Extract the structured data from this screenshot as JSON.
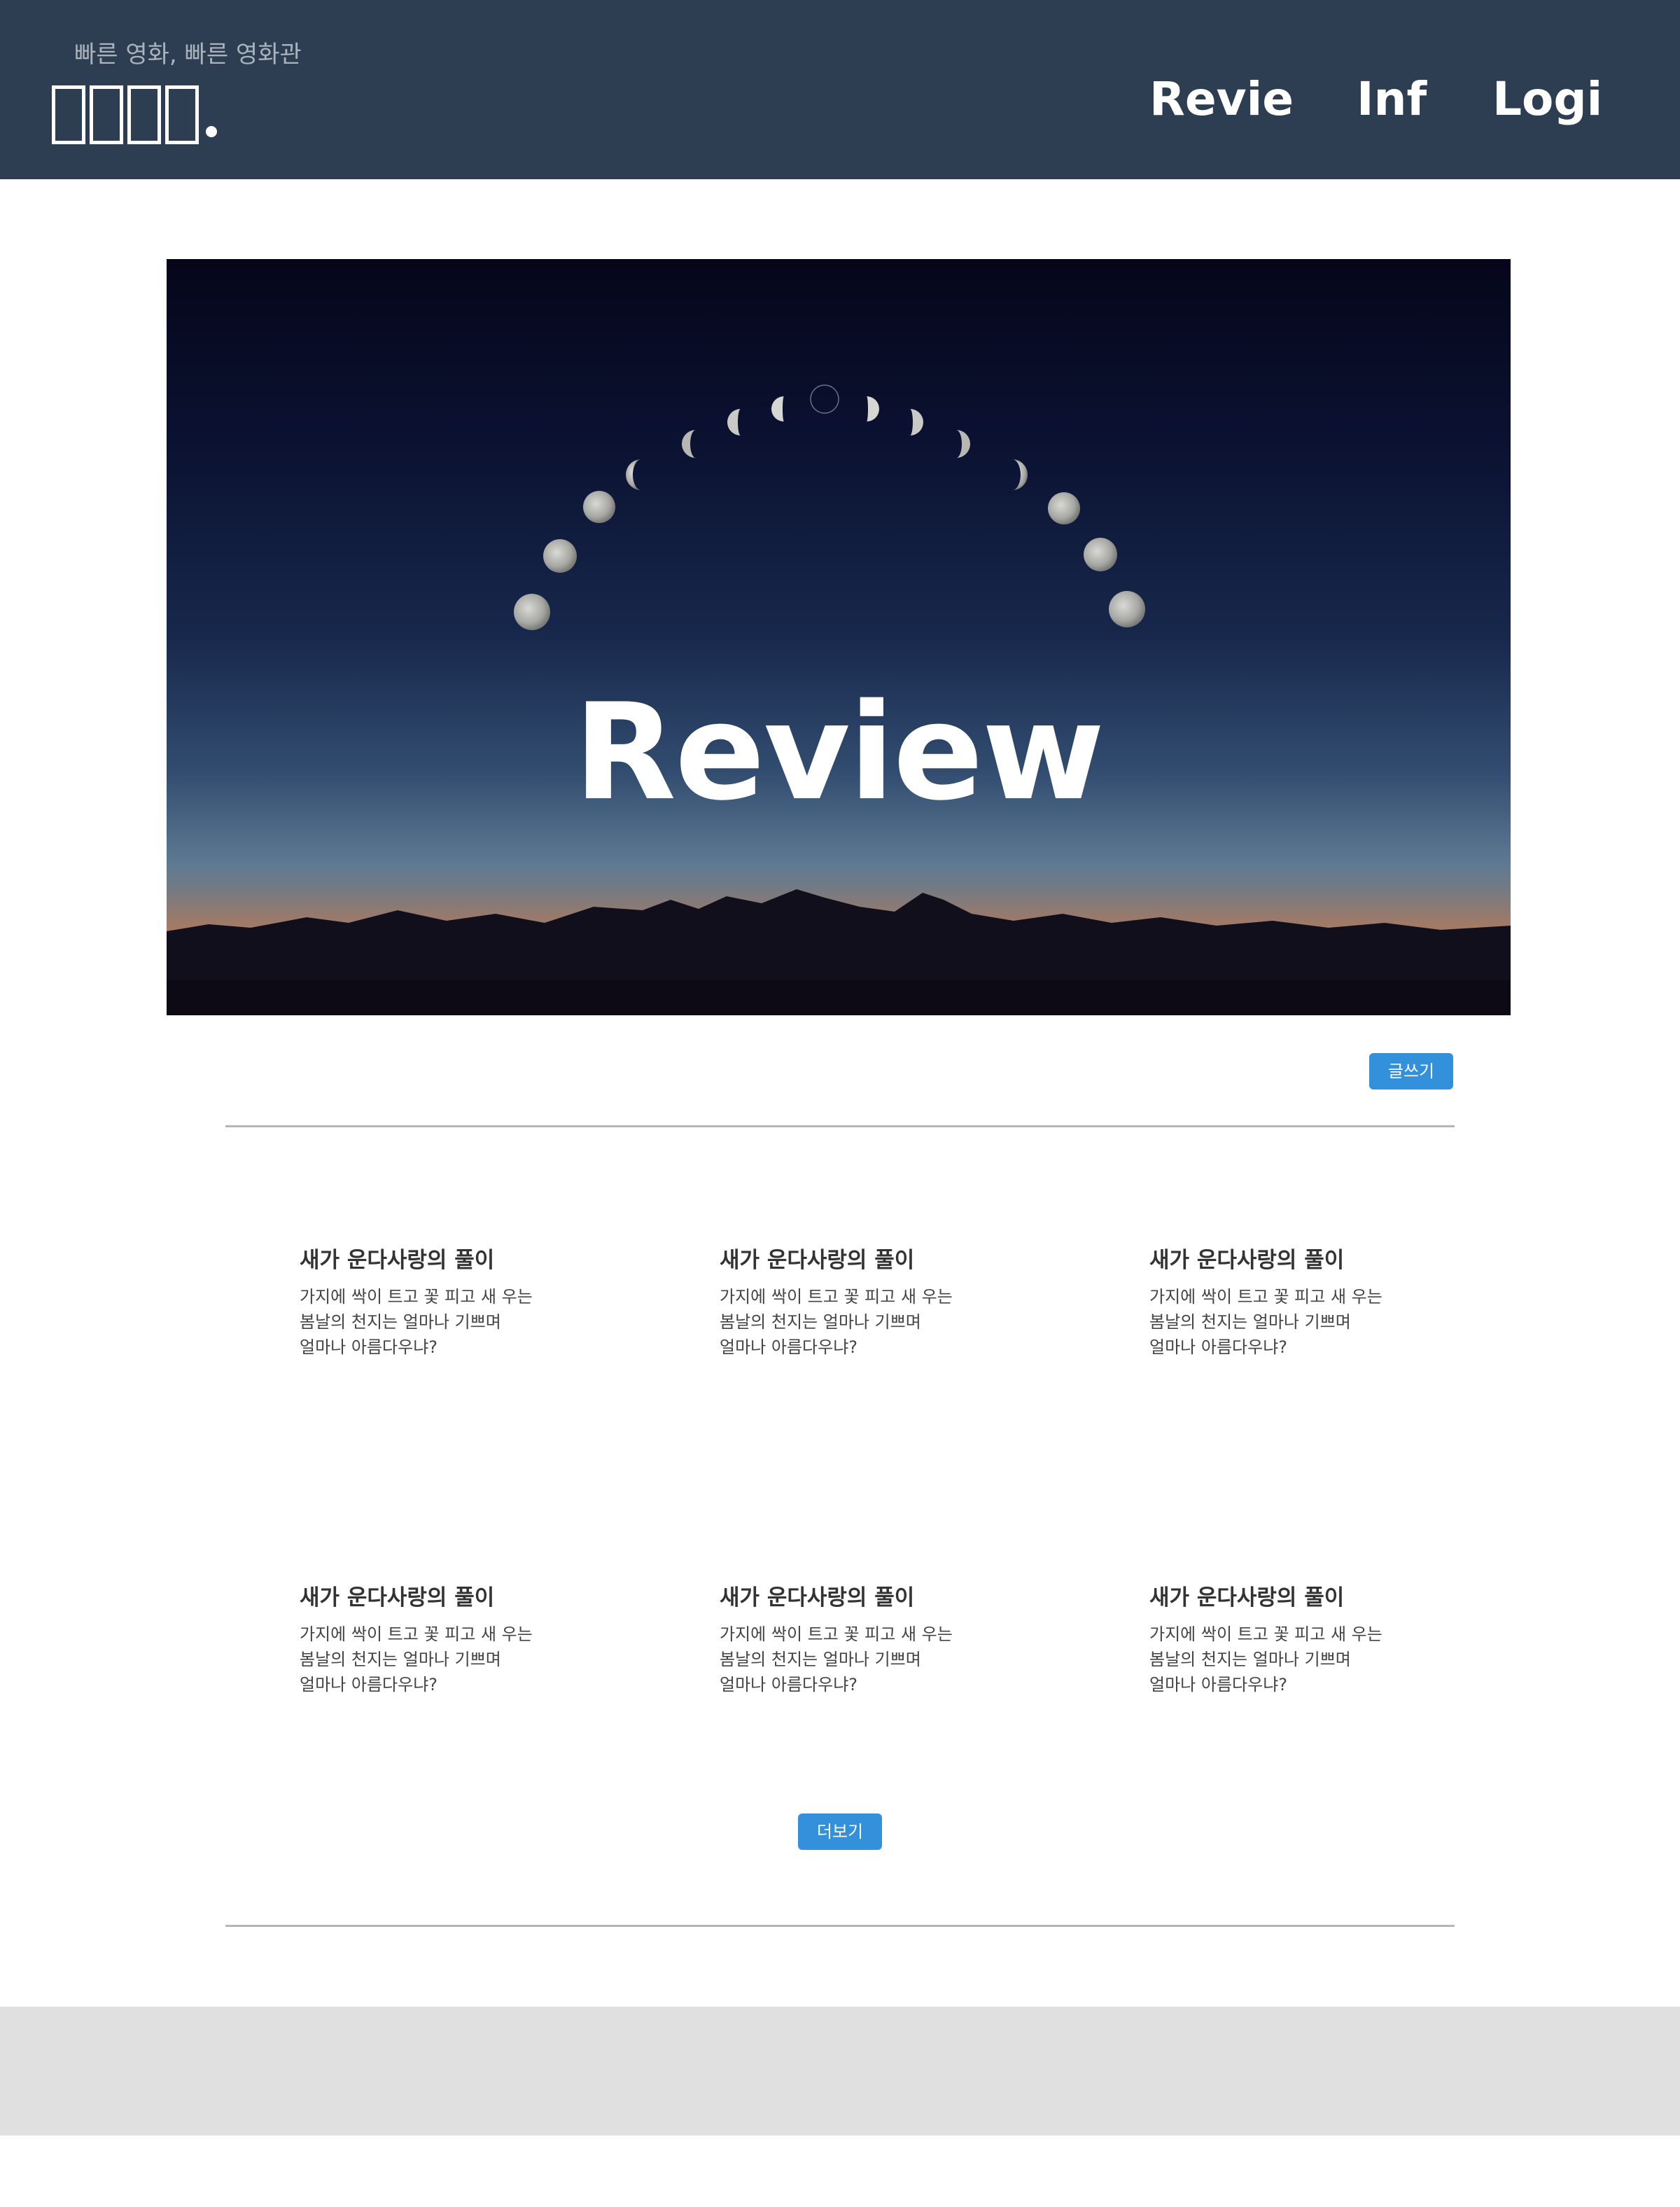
{
  "header": {
    "tagline": "빠른 영화, 빠른 영화관",
    "logo_char_count": 4,
    "nav": {
      "review": "Revie",
      "info": "Inf",
      "login": "Logi"
    },
    "background_color": "#2e3e52"
  },
  "hero": {
    "title": "Review",
    "image_description_icon": "moon-phases-night-sky"
  },
  "actions": {
    "write_label": "글쓰기",
    "more_label": "더보기",
    "button_color": "#3391db"
  },
  "posts": [
    {
      "title": "새가 운다사랑의 풀이",
      "lines": [
        "가지에 싹이 트고 꽃 피고 새 우는",
        "봄날의 천지는 얼마나 기쁘며",
        "얼마나 아름다우냐?"
      ]
    },
    {
      "title": "새가 운다사랑의 풀이",
      "lines": [
        "가지에 싹이 트고 꽃 피고 새 우는",
        "봄날의 천지는 얼마나 기쁘며",
        "얼마나 아름다우냐?"
      ]
    },
    {
      "title": "새가 운다사랑의 풀이",
      "lines": [
        "가지에 싹이 트고 꽃 피고 새 우는",
        "봄날의 천지는 얼마나 기쁘며",
        "얼마나 아름다우냐?"
      ]
    },
    {
      "title": "새가 운다사랑의 풀이",
      "lines": [
        "가지에 싹이 트고 꽃 피고 새 우는",
        "봄날의 천지는 얼마나 기쁘며",
        "얼마나 아름다우냐?"
      ]
    },
    {
      "title": "새가 운다사랑의 풀이",
      "lines": [
        "가지에 싹이 트고 꽃 피고 새 우는",
        "봄날의 천지는 얼마나 기쁘며",
        "얼마나 아름다우냐?"
      ]
    },
    {
      "title": "새가 운다사랑의 풀이",
      "lines": [
        "가지에 싹이 트고 꽃 피고 새 우는",
        "봄날의 천지는 얼마나 기쁘며",
        "얼마나 아름다우냐?"
      ]
    }
  ],
  "footer": {
    "background_color": "#e0e0e0"
  }
}
